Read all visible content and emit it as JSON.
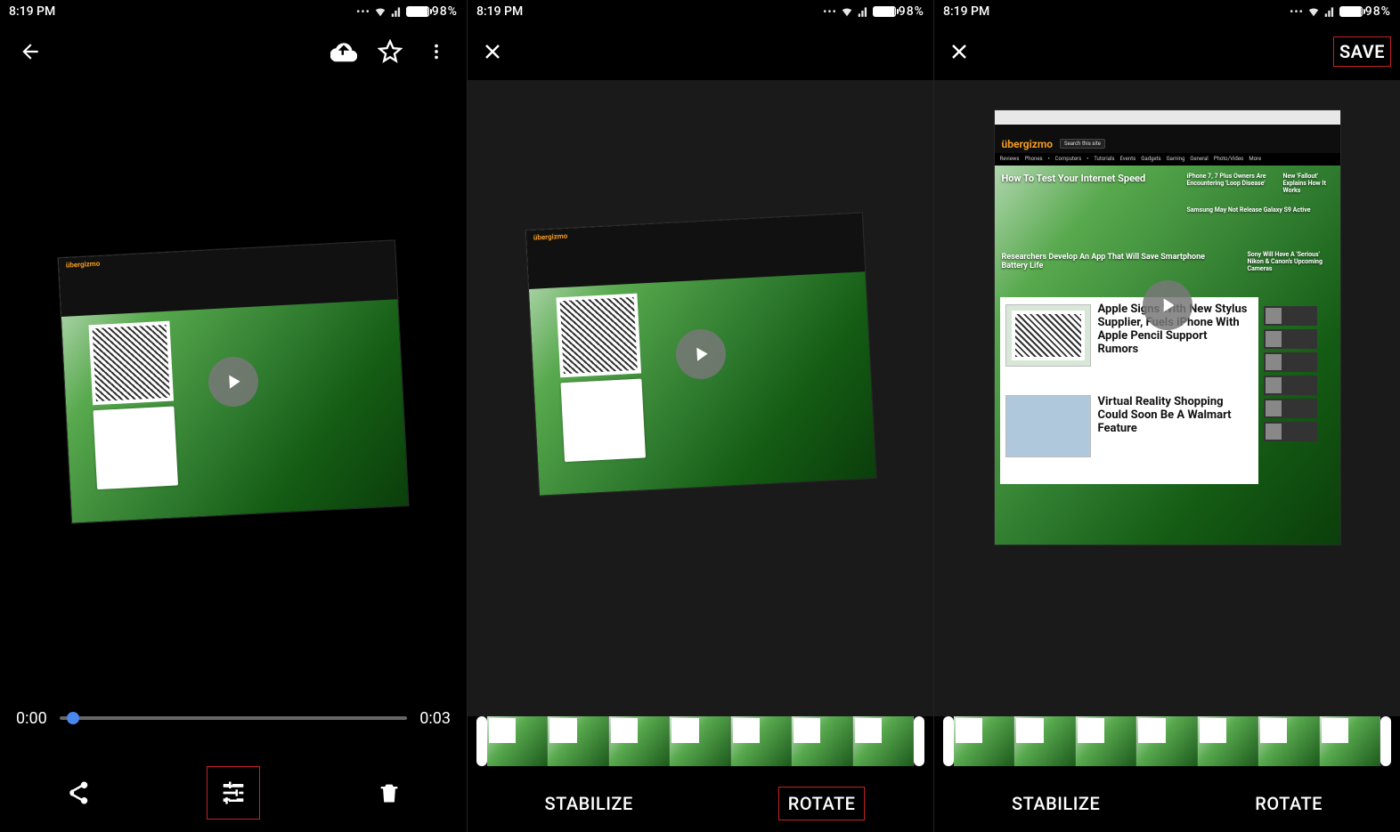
{
  "status": {
    "time": "8:19 PM",
    "battery": "98%"
  },
  "screen1": {
    "playback": {
      "current": "0:00",
      "duration": "0:03"
    }
  },
  "screen2": {
    "stabilize": "STABILIZE",
    "rotate": "ROTATE"
  },
  "screen3": {
    "save": "SAVE",
    "stabilize": "STABILIZE",
    "rotate": "ROTATE",
    "website": {
      "logo": "übergizmo",
      "search_placeholder": "Search this site",
      "nav": [
        "Reviews",
        "Phones",
        "Computers",
        "Tutorials",
        "Events",
        "Gadgets",
        "Gaming",
        "General",
        "Photo/Video",
        "More"
      ],
      "hero": "How To Test Your Internet Speed",
      "side_top": "iPhone 7, 7 Plus Owners Are Encountering 'Loop Disease'",
      "side_top2": "New 'Fallout' Explains How It Works",
      "strip": "Samsung May Not Release Galaxy S9 Active",
      "banner2": "Researchers Develop An App That Will Save Smartphone Battery Life",
      "side2": "Sony Will Have A 'Serious' Nikon & Canon's Upcoming Cameras",
      "article1": "Apple Signs With New Stylus Supplier, Fuels iPhone With Apple Pencil Support Rumors",
      "article2": "Virtual Reality Shopping Could Soon Be A Walmart Feature"
    }
  }
}
